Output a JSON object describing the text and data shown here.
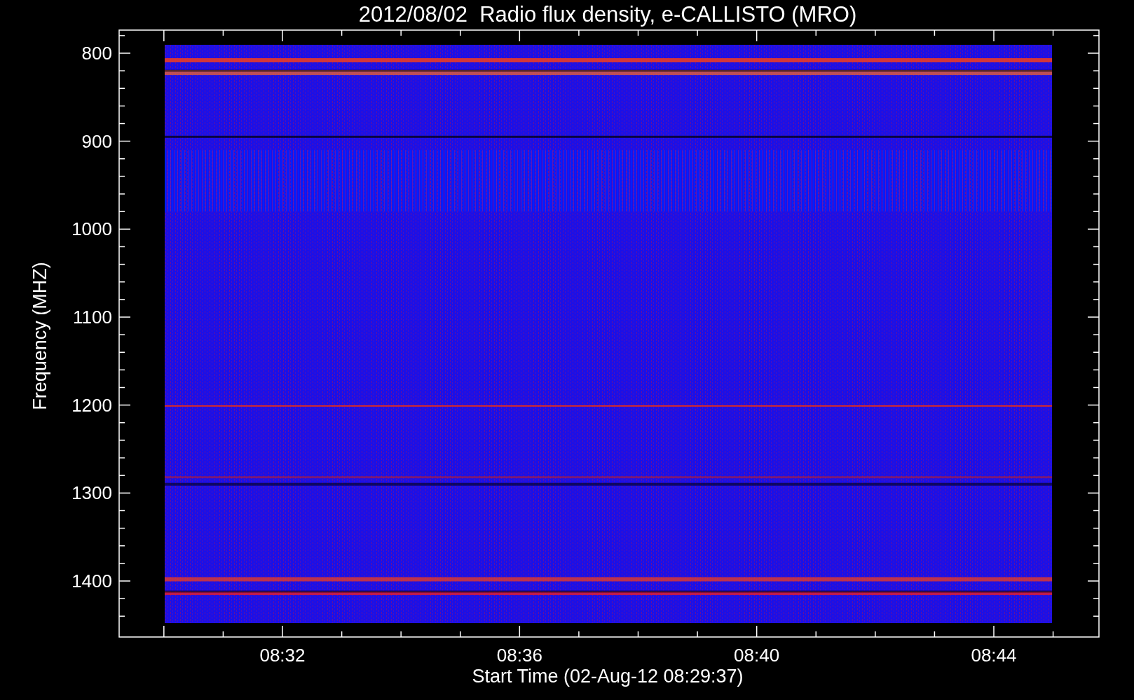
{
  "plot": {
    "title": "2012/08/02  Radio flux density, e-CALLISTO (MRO)",
    "y_axis": {
      "label": "Frequency (MHZ)",
      "ticks": [
        "800",
        "900",
        "1000",
        "1100",
        "1200",
        "1300",
        "1400"
      ]
    },
    "x_axis": {
      "label": "Start Time (02-Aug-12 08:29:37)",
      "ticks": [
        "08:32",
        "08:36",
        "08:40",
        "08:44"
      ]
    }
  }
}
